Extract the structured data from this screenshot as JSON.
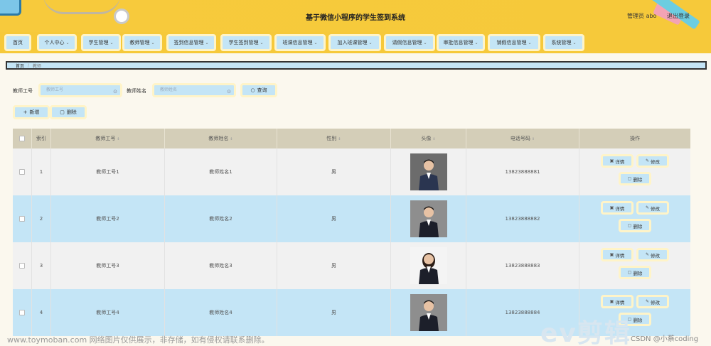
{
  "header": {
    "title": "基于微信小程序的学生签到系统",
    "user_label": "管理员 abo",
    "logout_label": "退出登录"
  },
  "nav": [
    {
      "label": "首页",
      "dropdown": false
    },
    {
      "label": "个人中心",
      "dropdown": true
    },
    {
      "label": "学生管理",
      "dropdown": true
    },
    {
      "label": "教师管理",
      "dropdown": true
    },
    {
      "label": "签到信息管理",
      "dropdown": true
    },
    {
      "label": "学生签到管理",
      "dropdown": true
    },
    {
      "label": "班课信息管理",
      "dropdown": true
    },
    {
      "label": "加入班课管理",
      "dropdown": true
    },
    {
      "label": "请假信息管理",
      "dropdown": true
    },
    {
      "label": "审批信息管理",
      "dropdown": true
    },
    {
      "label": "销假信息管理",
      "dropdown": true
    },
    {
      "label": "系统管理",
      "dropdown": true
    }
  ],
  "breadcrumb": {
    "home": "首页",
    "sep": "/",
    "current": "教师"
  },
  "search": {
    "field1_label": "教师工号",
    "field1_placeholder": "教师工号",
    "field2_label": "教师姓名",
    "field2_placeholder": "教师姓名",
    "query_label": "查询"
  },
  "actions": {
    "add_label": "新增",
    "delete_label": "删除"
  },
  "table": {
    "headers": [
      "索引",
      "教师工号",
      "教师姓名",
      "性别",
      "头像",
      "电话号码",
      "操作"
    ],
    "rows": [
      {
        "index": "1",
        "id": "教师工号1",
        "name": "教师姓名1",
        "gender": "男",
        "phone": "13823888881"
      },
      {
        "index": "2",
        "id": "教师工号2",
        "name": "教师姓名2",
        "gender": "男",
        "phone": "13823888882"
      },
      {
        "index": "3",
        "id": "教师工号3",
        "name": "教师姓名3",
        "gender": "男",
        "phone": "13823888883"
      },
      {
        "index": "4",
        "id": "教师工号4",
        "name": "教师姓名4",
        "gender": "男",
        "phone": "13823888884"
      }
    ],
    "op_detail": "详情",
    "op_edit": "修改",
    "op_delete": "删除"
  },
  "watermarks": {
    "left": "www.toymoban.com 网络图片仅供展示，非存储，如有侵权请联系删除。",
    "logo": "ev剪辑",
    "right": "CSDN @小蔡coding"
  },
  "colors": {
    "header_bg": "#f6c93a",
    "button_bg": "#c4e5f6",
    "button_border": "#fff4c8",
    "table_header": "#d4ceb8"
  }
}
